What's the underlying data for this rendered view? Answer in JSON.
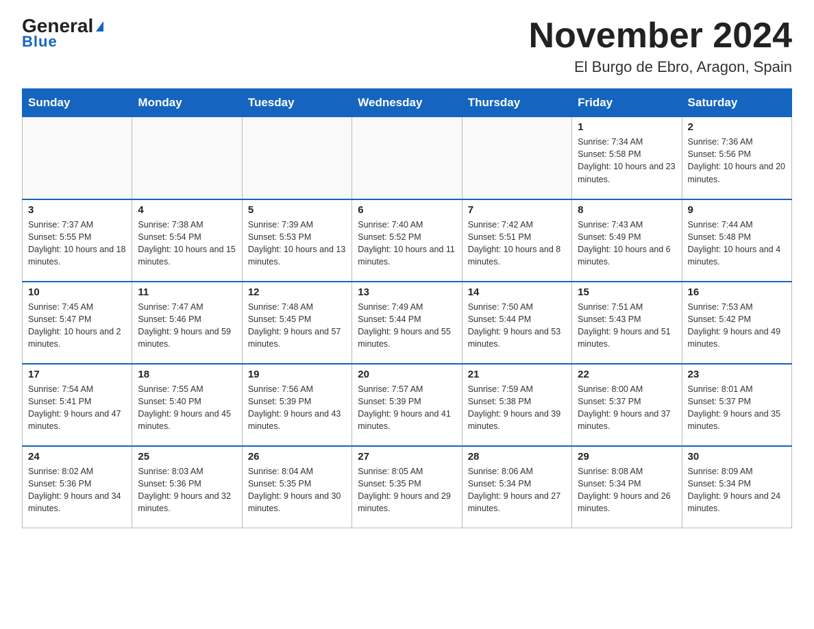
{
  "header": {
    "logo_general": "General",
    "logo_blue": "Blue",
    "title": "November 2024",
    "subtitle": "El Burgo de Ebro, Aragon, Spain"
  },
  "weekdays": [
    "Sunday",
    "Monday",
    "Tuesday",
    "Wednesday",
    "Thursday",
    "Friday",
    "Saturday"
  ],
  "weeks": [
    [
      {
        "day": "",
        "info": ""
      },
      {
        "day": "",
        "info": ""
      },
      {
        "day": "",
        "info": ""
      },
      {
        "day": "",
        "info": ""
      },
      {
        "day": "",
        "info": ""
      },
      {
        "day": "1",
        "info": "Sunrise: 7:34 AM\nSunset: 5:58 PM\nDaylight: 10 hours and 23 minutes."
      },
      {
        "day": "2",
        "info": "Sunrise: 7:36 AM\nSunset: 5:56 PM\nDaylight: 10 hours and 20 minutes."
      }
    ],
    [
      {
        "day": "3",
        "info": "Sunrise: 7:37 AM\nSunset: 5:55 PM\nDaylight: 10 hours and 18 minutes."
      },
      {
        "day": "4",
        "info": "Sunrise: 7:38 AM\nSunset: 5:54 PM\nDaylight: 10 hours and 15 minutes."
      },
      {
        "day": "5",
        "info": "Sunrise: 7:39 AM\nSunset: 5:53 PM\nDaylight: 10 hours and 13 minutes."
      },
      {
        "day": "6",
        "info": "Sunrise: 7:40 AM\nSunset: 5:52 PM\nDaylight: 10 hours and 11 minutes."
      },
      {
        "day": "7",
        "info": "Sunrise: 7:42 AM\nSunset: 5:51 PM\nDaylight: 10 hours and 8 minutes."
      },
      {
        "day": "8",
        "info": "Sunrise: 7:43 AM\nSunset: 5:49 PM\nDaylight: 10 hours and 6 minutes."
      },
      {
        "day": "9",
        "info": "Sunrise: 7:44 AM\nSunset: 5:48 PM\nDaylight: 10 hours and 4 minutes."
      }
    ],
    [
      {
        "day": "10",
        "info": "Sunrise: 7:45 AM\nSunset: 5:47 PM\nDaylight: 10 hours and 2 minutes."
      },
      {
        "day": "11",
        "info": "Sunrise: 7:47 AM\nSunset: 5:46 PM\nDaylight: 9 hours and 59 minutes."
      },
      {
        "day": "12",
        "info": "Sunrise: 7:48 AM\nSunset: 5:45 PM\nDaylight: 9 hours and 57 minutes."
      },
      {
        "day": "13",
        "info": "Sunrise: 7:49 AM\nSunset: 5:44 PM\nDaylight: 9 hours and 55 minutes."
      },
      {
        "day": "14",
        "info": "Sunrise: 7:50 AM\nSunset: 5:44 PM\nDaylight: 9 hours and 53 minutes."
      },
      {
        "day": "15",
        "info": "Sunrise: 7:51 AM\nSunset: 5:43 PM\nDaylight: 9 hours and 51 minutes."
      },
      {
        "day": "16",
        "info": "Sunrise: 7:53 AM\nSunset: 5:42 PM\nDaylight: 9 hours and 49 minutes."
      }
    ],
    [
      {
        "day": "17",
        "info": "Sunrise: 7:54 AM\nSunset: 5:41 PM\nDaylight: 9 hours and 47 minutes."
      },
      {
        "day": "18",
        "info": "Sunrise: 7:55 AM\nSunset: 5:40 PM\nDaylight: 9 hours and 45 minutes."
      },
      {
        "day": "19",
        "info": "Sunrise: 7:56 AM\nSunset: 5:39 PM\nDaylight: 9 hours and 43 minutes."
      },
      {
        "day": "20",
        "info": "Sunrise: 7:57 AM\nSunset: 5:39 PM\nDaylight: 9 hours and 41 minutes."
      },
      {
        "day": "21",
        "info": "Sunrise: 7:59 AM\nSunset: 5:38 PM\nDaylight: 9 hours and 39 minutes."
      },
      {
        "day": "22",
        "info": "Sunrise: 8:00 AM\nSunset: 5:37 PM\nDaylight: 9 hours and 37 minutes."
      },
      {
        "day": "23",
        "info": "Sunrise: 8:01 AM\nSunset: 5:37 PM\nDaylight: 9 hours and 35 minutes."
      }
    ],
    [
      {
        "day": "24",
        "info": "Sunrise: 8:02 AM\nSunset: 5:36 PM\nDaylight: 9 hours and 34 minutes."
      },
      {
        "day": "25",
        "info": "Sunrise: 8:03 AM\nSunset: 5:36 PM\nDaylight: 9 hours and 32 minutes."
      },
      {
        "day": "26",
        "info": "Sunrise: 8:04 AM\nSunset: 5:35 PM\nDaylight: 9 hours and 30 minutes."
      },
      {
        "day": "27",
        "info": "Sunrise: 8:05 AM\nSunset: 5:35 PM\nDaylight: 9 hours and 29 minutes."
      },
      {
        "day": "28",
        "info": "Sunrise: 8:06 AM\nSunset: 5:34 PM\nDaylight: 9 hours and 27 minutes."
      },
      {
        "day": "29",
        "info": "Sunrise: 8:08 AM\nSunset: 5:34 PM\nDaylight: 9 hours and 26 minutes."
      },
      {
        "day": "30",
        "info": "Sunrise: 8:09 AM\nSunset: 5:34 PM\nDaylight: 9 hours and 24 minutes."
      }
    ]
  ]
}
